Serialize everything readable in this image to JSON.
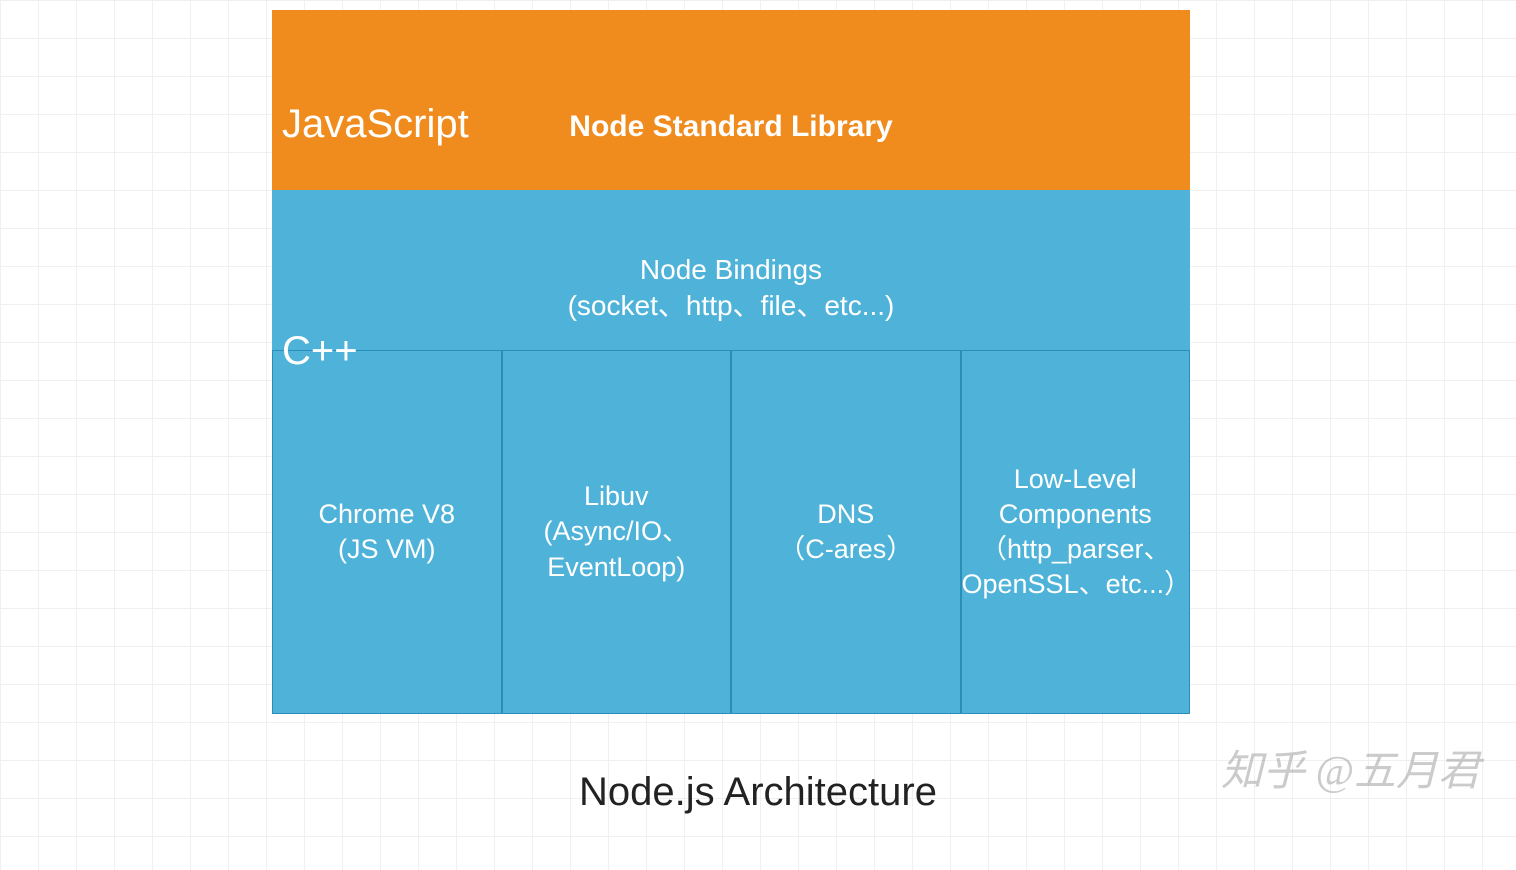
{
  "colors": {
    "layer_js": "#f08c1e",
    "layer_cpp": "#4fb3d9",
    "cell_border": "#2a8fb8",
    "text_light": "#ffffff",
    "text_dark": "#222222",
    "grid_line": "#f0f0f0"
  },
  "layers": {
    "top": {
      "language_label": "JavaScript",
      "library_label": "Node Standard Library"
    },
    "bottom": {
      "language_label": "C++",
      "bindings": {
        "title": "Node Bindings",
        "subtitle": "(socket、http、file、etc...)"
      },
      "components": [
        {
          "name": "Chrome V8",
          "detail": "(JS VM)"
        },
        {
          "name": "Libuv",
          "detail": "(Async/IO、EventLoop)"
        },
        {
          "name": "DNS",
          "detail": "（C-ares）"
        },
        {
          "name": "Low-Level Components",
          "detail": "（http_parser、OpenSSL、etc...）"
        }
      ]
    }
  },
  "caption": "Node.js Architecture",
  "watermark": "知乎 @五月君"
}
